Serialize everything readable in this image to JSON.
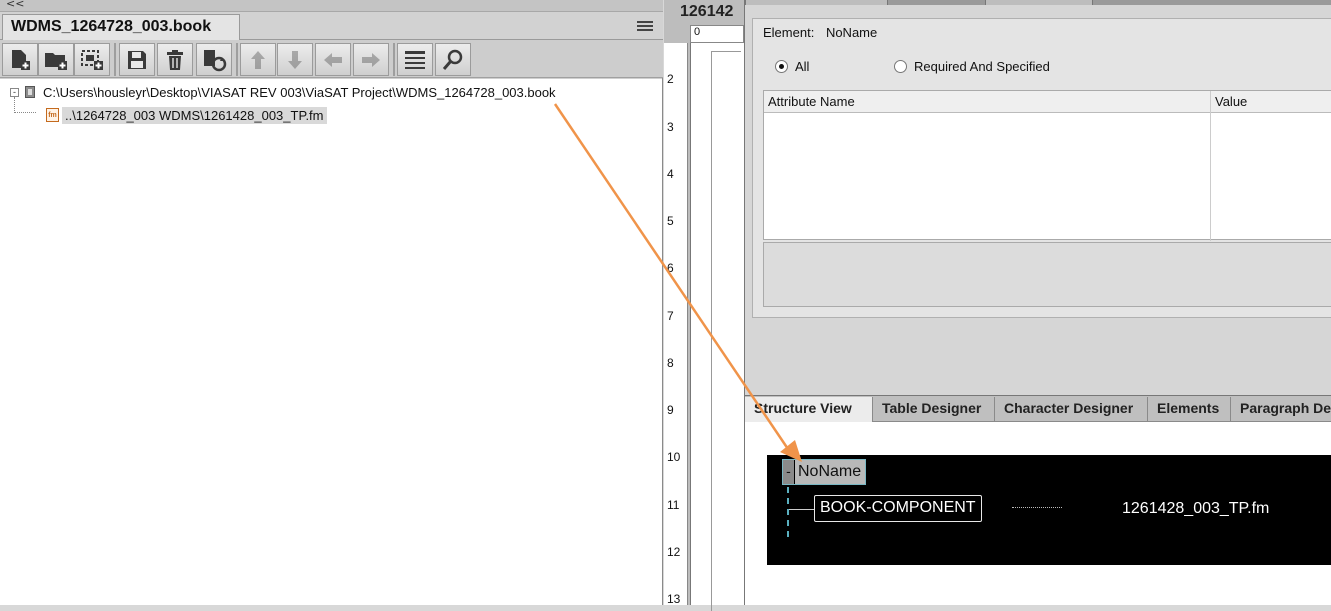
{
  "book_panel": {
    "collapse_glyph": "<<",
    "tab_title": "WDMS_1264728_003.book",
    "toolbar": [
      {
        "name": "add-file-icon",
        "enabled": true
      },
      {
        "name": "add-folder-icon",
        "enabled": true
      },
      {
        "name": "add-group-icon",
        "enabled": true
      },
      {
        "name": "save-icon",
        "enabled": true
      },
      {
        "name": "delete-icon",
        "enabled": true
      },
      {
        "name": "update-book-icon",
        "enabled": true
      },
      {
        "name": "move-up-icon",
        "enabled": false
      },
      {
        "name": "move-down-icon",
        "enabled": false
      },
      {
        "name": "move-left-icon",
        "enabled": false
      },
      {
        "name": "move-right-icon",
        "enabled": false
      },
      {
        "name": "list-icon",
        "enabled": true
      },
      {
        "name": "search-icon",
        "enabled": true
      }
    ],
    "tree": {
      "root_expander": "-",
      "root_label": "C:\\Users\\housleyr\\Desktop\\VIASAT REV 003\\ViaSAT Project\\WDMS_1264728_003.book",
      "child_icon_text": "fm",
      "child_label": "..\\1264728_003 WDMS\\1261428_003_TP.fm"
    }
  },
  "document": {
    "title": "126142",
    "h_ruler_label": "0",
    "v_ruler": [
      "2",
      "3",
      "4",
      "5",
      "6",
      "7",
      "8",
      "9",
      "10",
      "11",
      "12",
      "13"
    ]
  },
  "attributes": {
    "element_label": "Element:",
    "element_value": "NoName",
    "radio_all": "All",
    "radio_required": "Required And Specified",
    "col_attribute_name": "Attribute Name",
    "col_value": "Value"
  },
  "structure_view": {
    "tabs": [
      "Structure View",
      "Table Designer",
      "Character Designer",
      "Elements",
      "Paragraph De"
    ],
    "root_collapse": "-",
    "root_label": "NoName",
    "child_label": "BOOK-COMPONENT",
    "child_file": "1261428_003_TP.fm"
  },
  "colors": {
    "arrow": "#f0944a",
    "structure_bg": "#000000",
    "selection_outline": "#7ab8c4"
  }
}
